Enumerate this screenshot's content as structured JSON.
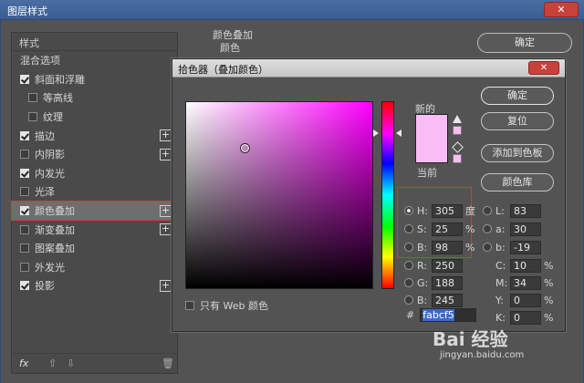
{
  "window": {
    "title": "图层样式",
    "close_label": "✕"
  },
  "left_panel": {
    "header": "样式",
    "items": [
      {
        "label": "混合选项",
        "checkbox": false,
        "checked": false,
        "sub": false,
        "plus": false,
        "selected": false
      },
      {
        "label": "斜面和浮雕",
        "checkbox": true,
        "checked": true,
        "sub": false,
        "plus": false,
        "selected": false
      },
      {
        "label": "等高线",
        "checkbox": true,
        "checked": false,
        "sub": true,
        "plus": false,
        "selected": false
      },
      {
        "label": "纹理",
        "checkbox": true,
        "checked": false,
        "sub": true,
        "plus": false,
        "selected": false
      },
      {
        "label": "描边",
        "checkbox": true,
        "checked": true,
        "sub": false,
        "plus": true,
        "selected": false
      },
      {
        "label": "内阴影",
        "checkbox": true,
        "checked": false,
        "sub": false,
        "plus": true,
        "selected": false
      },
      {
        "label": "内发光",
        "checkbox": true,
        "checked": true,
        "sub": false,
        "plus": false,
        "selected": false
      },
      {
        "label": "光泽",
        "checkbox": true,
        "checked": false,
        "sub": false,
        "plus": false,
        "selected": false
      },
      {
        "label": "颜色叠加",
        "checkbox": true,
        "checked": true,
        "sub": false,
        "plus": true,
        "selected": true
      },
      {
        "label": "渐变叠加",
        "checkbox": true,
        "checked": false,
        "sub": false,
        "plus": true,
        "selected": false
      },
      {
        "label": "图案叠加",
        "checkbox": true,
        "checked": false,
        "sub": false,
        "plus": false,
        "selected": false
      },
      {
        "label": "外发光",
        "checkbox": true,
        "checked": false,
        "sub": false,
        "plus": false,
        "selected": false
      },
      {
        "label": "投影",
        "checkbox": true,
        "checked": true,
        "sub": false,
        "plus": true,
        "selected": false
      }
    ],
    "footer": {
      "fx_label": "fx",
      "up_label": "⇧",
      "down_label": "⇩",
      "trash_label": "🗑"
    }
  },
  "overlay_group": {
    "title": "颜色叠加",
    "subtitle": "颜色"
  },
  "outer_buttons": {
    "ok": "确定"
  },
  "picker": {
    "title": "拾色器（叠加颜色）",
    "close_label": "✕",
    "new_label": "新的",
    "current_label": "当前",
    "new_color": "#fabcf5",
    "current_color": "#fabcf5",
    "hue_color": "#ff00ff",
    "highlight_color": "#c84040",
    "buttons": {
      "ok": "确定",
      "reset": "复位",
      "add_swatch": "添加到色板",
      "library": "颜色库"
    },
    "web_only_label": "只有 Web 颜色",
    "hsb": [
      {
        "key": "H:",
        "value": "305",
        "unit": "度",
        "selected": true
      },
      {
        "key": "S:",
        "value": "25",
        "unit": "%",
        "selected": false
      },
      {
        "key": "B:",
        "value": "98",
        "unit": "%",
        "selected": false
      }
    ],
    "rgb": [
      {
        "key": "R:",
        "value": "250"
      },
      {
        "key": "G:",
        "value": "188"
      },
      {
        "key": "B:",
        "value": "245"
      }
    ],
    "lab": [
      {
        "key": "L:",
        "value": "83"
      },
      {
        "key": "a:",
        "value": "30"
      },
      {
        "key": "b:",
        "value": "-19"
      }
    ],
    "cmyk": [
      {
        "key": "C:",
        "value": "10",
        "unit": "%"
      },
      {
        "key": "M:",
        "value": "34",
        "unit": "%"
      },
      {
        "key": "Y:",
        "value": "0",
        "unit": "%"
      },
      {
        "key": "K:",
        "value": "0",
        "unit": "%"
      }
    ],
    "hex_label": "#",
    "hex_value": "fabcf5"
  },
  "watermark": {
    "text": "Bai 经验",
    "url": "jingyan.baidu.com"
  }
}
